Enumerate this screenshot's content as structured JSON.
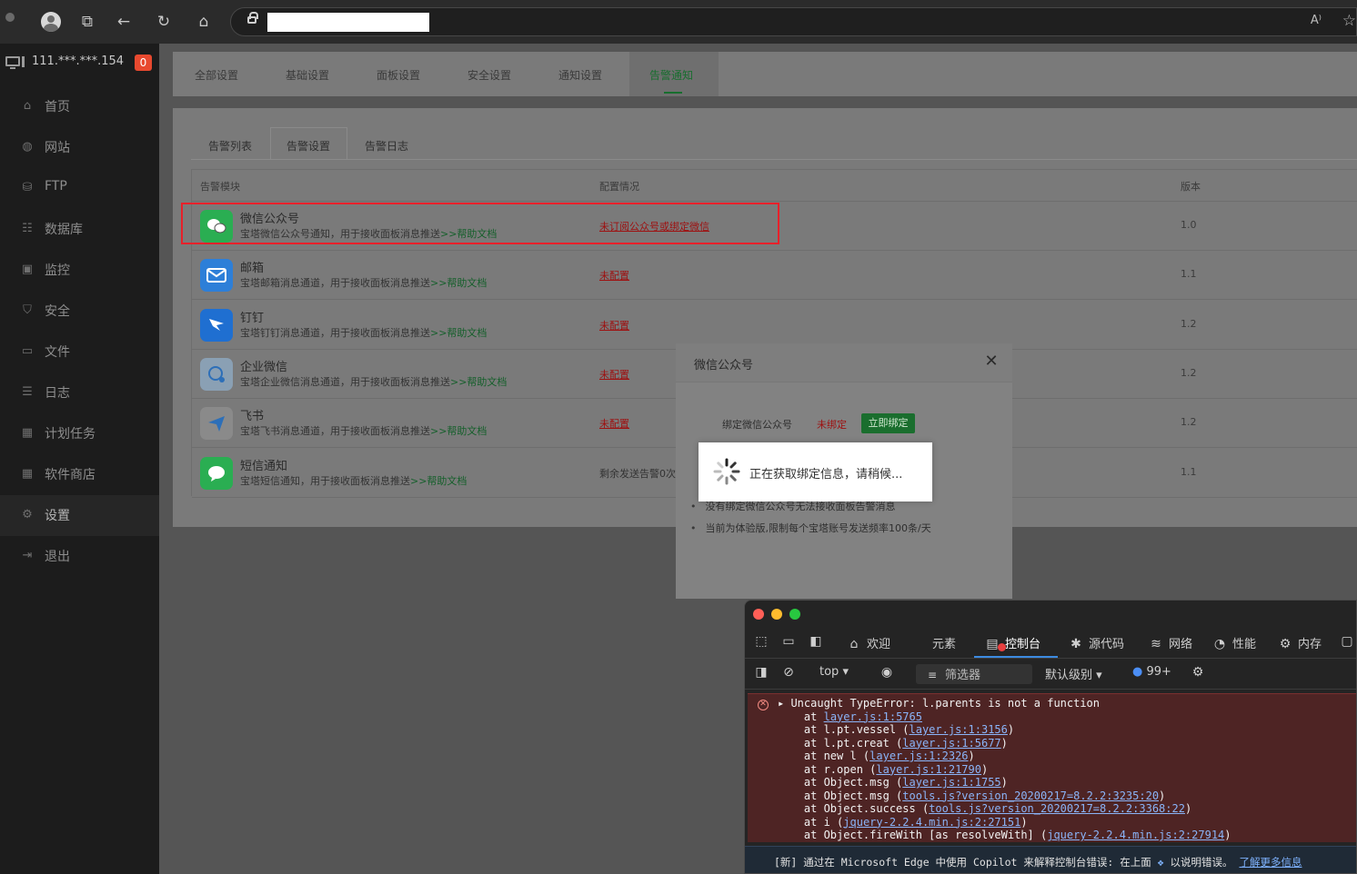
{
  "browser": {
    "read_aloud_label": "A⁾"
  },
  "sidebar": {
    "server_ip": "111.***.***.154",
    "badge_count": "0",
    "items": [
      {
        "label": "首页",
        "icon": "home-icon"
      },
      {
        "label": "网站",
        "icon": "globe-icon"
      },
      {
        "label": "FTP",
        "icon": "ftp-icon"
      },
      {
        "label": "数据库",
        "icon": "database-icon"
      },
      {
        "label": "监控",
        "icon": "monitor-chart-icon"
      },
      {
        "label": "安全",
        "icon": "shield-icon"
      },
      {
        "label": "文件",
        "icon": "folder-icon"
      },
      {
        "label": "日志",
        "icon": "log-icon"
      },
      {
        "label": "计划任务",
        "icon": "calendar-icon"
      },
      {
        "label": "软件商店",
        "icon": "apps-icon"
      },
      {
        "label": "设置",
        "icon": "gear-icon"
      },
      {
        "label": "退出",
        "icon": "logout-icon"
      }
    ]
  },
  "top_tabs": [
    "全部设置",
    "基础设置",
    "面板设置",
    "安全设置",
    "通知设置",
    "告警通知"
  ],
  "sub_tabs": [
    "告警列表",
    "告警设置",
    "告警日志"
  ],
  "table": {
    "headers": [
      "告警模块",
      "配置情况",
      "版本"
    ],
    "help_link": ">>帮助文档",
    "rows": [
      {
        "name": "微信公众号",
        "desc": "宝塔微信公众号通知，用于接收面板消息推送",
        "config": "未订阅公众号或绑定微信",
        "version": "1.0",
        "color": "#2aae52"
      },
      {
        "name": "邮箱",
        "desc": "宝塔邮箱消息通道，用于接收面板消息推送",
        "config": "未配置",
        "version": "1.1",
        "color": "#2d7fd8"
      },
      {
        "name": "钉钉",
        "desc": "宝塔钉钉消息通道，用于接收面板消息推送",
        "config": "未配置",
        "version": "1.2",
        "color": "#1f6fd1"
      },
      {
        "name": "企业微信",
        "desc": "宝塔企业微信消息通道，用于接收面板消息推送",
        "config": "未配置",
        "version": "1.2",
        "color": "#8aa0b4"
      },
      {
        "name": "飞书",
        "desc": "宝塔飞书消息通道，用于接收面板消息推送",
        "config": "未配置",
        "version": "1.2",
        "color": "#8a8a8a"
      },
      {
        "name": "短信通知",
        "desc": "宝塔短信通知，用于接收面板消息推送",
        "config": "剩余发送告警0次",
        "version": "1.1",
        "color": "#2aae52"
      }
    ]
  },
  "modal": {
    "title": "微信公众号",
    "bind_label": "绑定微信公众号",
    "bind_status": "未绑定",
    "bind_button": "立即绑定",
    "tips": [
      "没有绑定微信公众号无法接收面板告警消息",
      "当前为体验版,限制每个宝塔账号发送频率100条/天"
    ],
    "loading_text": "正在获取绑定信息，请稍候..."
  },
  "devtools": {
    "tabs": [
      {
        "label": "欢迎",
        "icon": "home-icon"
      },
      {
        "label": "元素",
        "icon": "code-icon"
      },
      {
        "label": "控制台",
        "icon": "console-icon"
      },
      {
        "label": "源代码",
        "icon": "bug-icon"
      },
      {
        "label": "网络",
        "icon": "wifi-icon"
      },
      {
        "label": "性能",
        "icon": "performance-icon"
      },
      {
        "label": "内存",
        "icon": "memory-icon"
      }
    ],
    "context": "top",
    "filter_placeholder": "筛选器",
    "level": "默认级别",
    "issues_count": "99+",
    "error": {
      "message": "Uncaught TypeError: l.parents is not a function",
      "stack": [
        {
          "prefix": "at ",
          "link": "layer.js:1:5765"
        },
        {
          "prefix": "at l.pt.vessel (",
          "link": "layer.js:1:3156",
          "suffix": ")"
        },
        {
          "prefix": "at l.pt.creat (",
          "link": "layer.js:1:5677",
          "suffix": ")"
        },
        {
          "prefix": "at new l (",
          "link": "layer.js:1:2326",
          "suffix": ")"
        },
        {
          "prefix": "at r.open (",
          "link": "layer.js:1:21790",
          "suffix": ")"
        },
        {
          "prefix": "at Object.msg (",
          "link": "layer.js:1:1755",
          "suffix": ")"
        },
        {
          "prefix": "at Object.msg (",
          "link": "tools.js?version_20200217=8.2.2:3235:20",
          "suffix": ")"
        },
        {
          "prefix": "at Object.success (",
          "link": "tools.js?version_20200217=8.2.2:3368:22",
          "suffix": ")"
        },
        {
          "prefix": "at i (",
          "link": "jquery-2.2.4.min.js:2:27151",
          "suffix": ")"
        },
        {
          "prefix": "at Object.fireWith [as resolveWith] (",
          "link": "jquery-2.2.4.min.js:2:27914",
          "suffix": ")"
        }
      ]
    },
    "copilot_text": "[新] 通过在 Microsoft Edge 中使用 Copilot 来解释控制台错误: 在上面",
    "copilot_text2": "以说明错误。",
    "copilot_link": "了解更多信息"
  }
}
